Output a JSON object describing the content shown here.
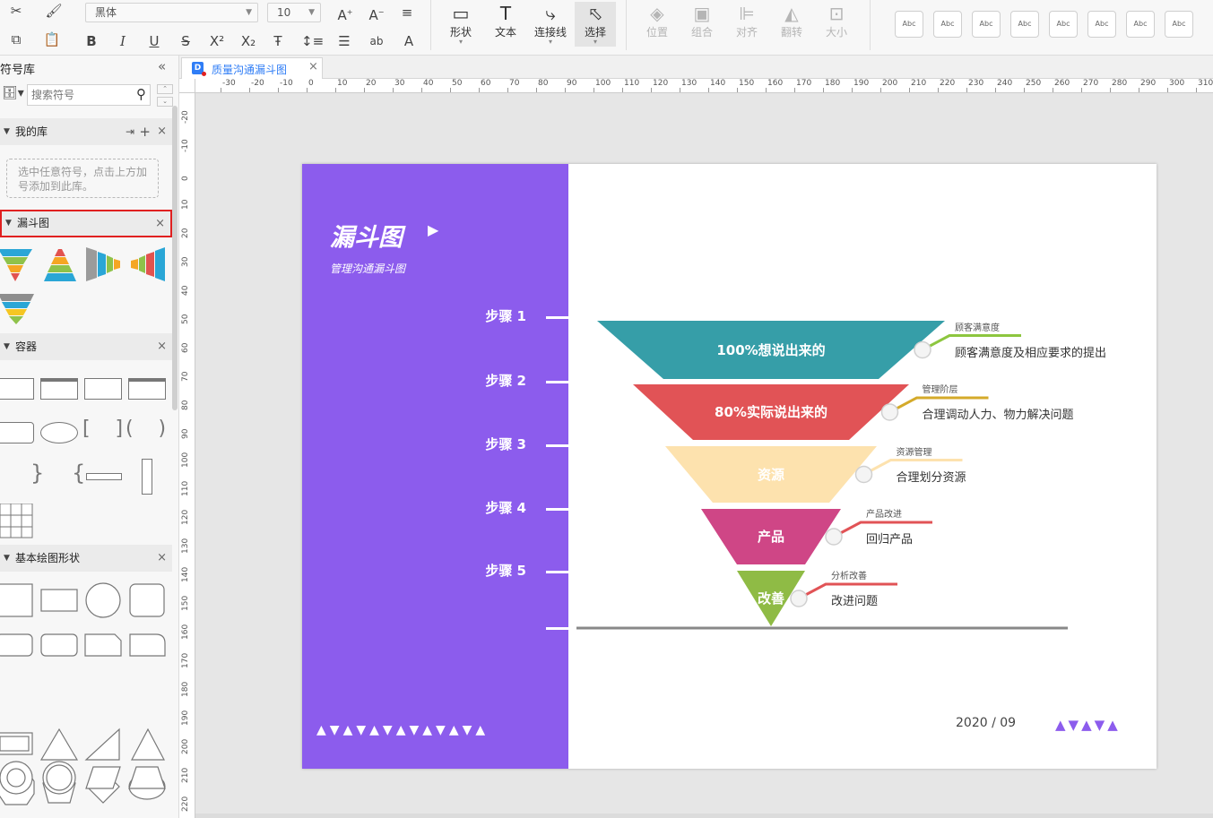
{
  "toolbar": {
    "font_name": "黑体",
    "font_size": "10",
    "tools": [
      {
        "label": "形状"
      },
      {
        "label": "文本"
      },
      {
        "label": "连接线"
      },
      {
        "label": "选择"
      }
    ],
    "arrange": [
      {
        "label": "位置"
      },
      {
        "label": "组合"
      },
      {
        "label": "对齐"
      },
      {
        "label": "翻转"
      },
      {
        "label": "大小"
      }
    ],
    "style_presets": [
      "Abc",
      "Abc",
      "Abc",
      "Abc",
      "Abc",
      "Abc",
      "Abc",
      "Abc"
    ]
  },
  "left_panel": {
    "title": "符号库",
    "search_placeholder": "搜索符号",
    "my_library": {
      "title": "我的库",
      "hint": "选中任意符号，点击上方加号添加到此库。"
    },
    "funnel_section": {
      "title": "漏斗图"
    },
    "container_section": {
      "title": "容器"
    },
    "basic_section": {
      "title": "基本绘图形状"
    }
  },
  "document": {
    "tab_title": "质量沟通漏斗图"
  },
  "ruler": {
    "h_labels": [
      "-30",
      "-20",
      "-10",
      "0",
      "10",
      "20",
      "30",
      "40",
      "50",
      "60",
      "70",
      "80",
      "90",
      "100",
      "110",
      "120",
      "130",
      "140",
      "150",
      "160",
      "170",
      "180",
      "190",
      "200",
      "210",
      "220",
      "230",
      "240",
      "250",
      "260",
      "270",
      "280",
      "290",
      "300",
      "310"
    ],
    "v_labels": [
      "-20",
      "-10",
      "0",
      "10",
      "20",
      "30",
      "40",
      "50",
      "60",
      "70",
      "80",
      "90",
      "100",
      "110",
      "120",
      "130",
      "140",
      "150",
      "160",
      "170",
      "180",
      "190",
      "200",
      "210",
      "220"
    ]
  },
  "slide": {
    "title": "漏斗图",
    "subtitle": "管理沟通漏斗图",
    "steps": [
      "步骤 1",
      "步骤 2",
      "步骤 3",
      "步骤 4",
      "步骤 5"
    ],
    "funnel": [
      {
        "label": "100%想说出来的",
        "color": "#369ea8",
        "text_color": "#ffffff",
        "anno_title": "顾客满意度",
        "anno_desc": "顾客满意度及相应要求的提出",
        "line_color": "#8dc63f"
      },
      {
        "label": "80%实际说出来的",
        "color": "#e15356",
        "text_color": "#ffffff",
        "anno_title": "管理阶层",
        "anno_desc": "合理调动人力、物力解决问题",
        "line_color": "#d4aa2a"
      },
      {
        "label": "资源",
        "color": "#fde2ae",
        "text_color": "#ffffff",
        "anno_title": "资源管理",
        "anno_desc": "合理划分资源",
        "line_color": "#fde2ae"
      },
      {
        "label": "产品",
        "color": "#cf4686",
        "text_color": "#ffffff",
        "anno_title": "产品改进",
        "anno_desc": "回归产品",
        "line_color": "#e15356"
      },
      {
        "label": "改善",
        "color": "#8fbb45",
        "text_color": "#ffffff",
        "anno_title": "分析改善",
        "anno_desc": "改进问题",
        "line_color": "#e15356"
      }
    ],
    "date": "2020 / 09",
    "accent_color": "#8c5ced"
  }
}
